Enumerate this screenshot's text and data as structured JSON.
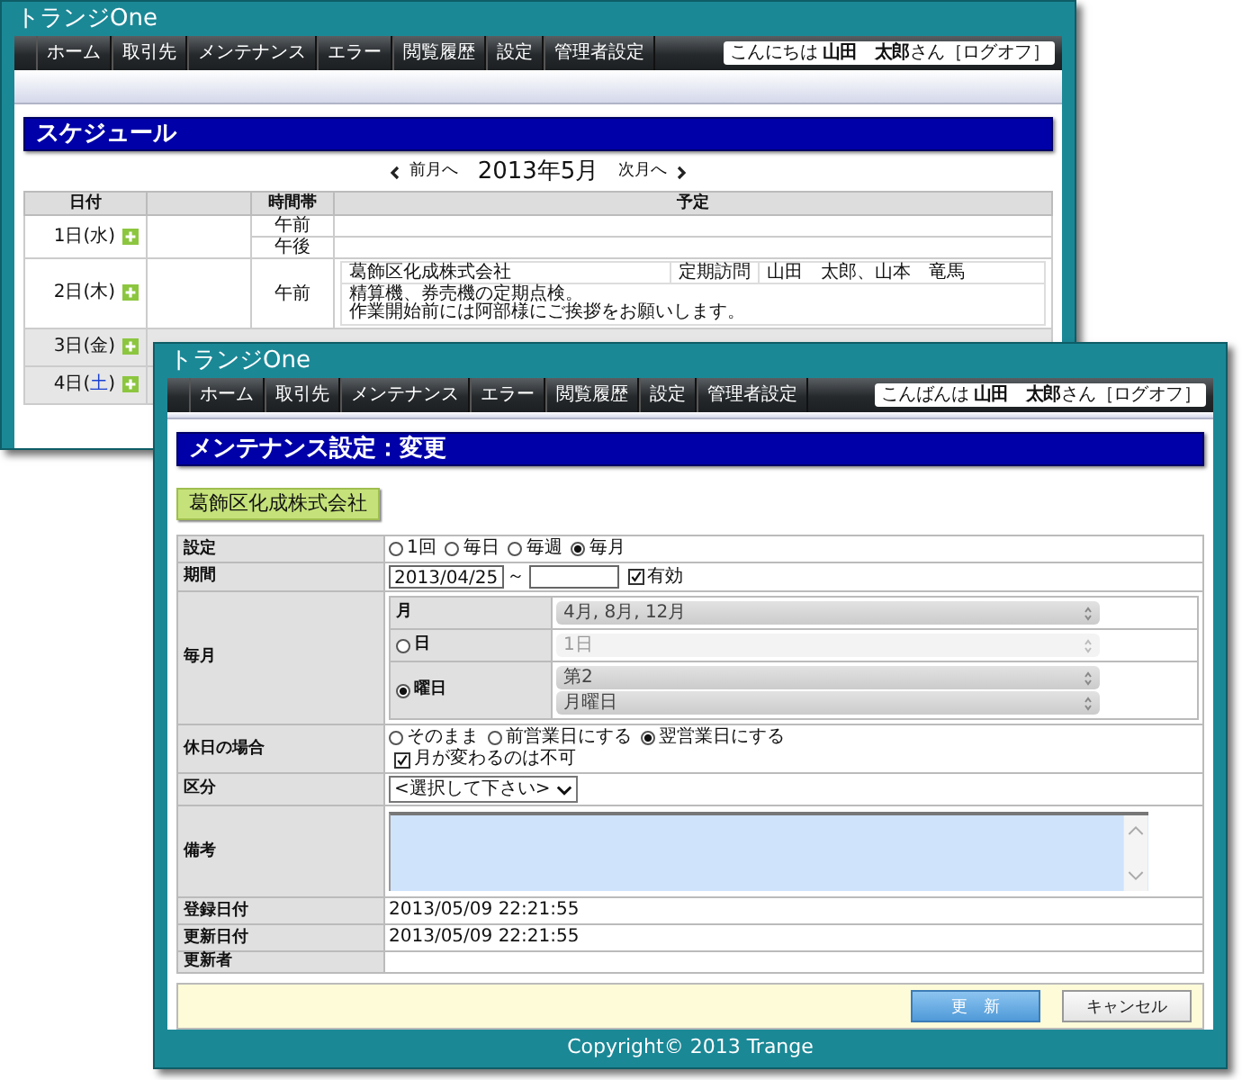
{
  "back_window": {
    "title": "トランジOne",
    "nav": [
      "ホーム",
      "取引先",
      "メンテナンス",
      "エラー",
      "閲覧履歴",
      "設定",
      "管理者設定"
    ],
    "greeting": "こんにちは **山田　太郎**さん",
    "logoff": "［ログオフ］",
    "heading": "スケジュール",
    "month_nav": {
      "prev": "前月へ",
      "current": "2013年5月",
      "next": "次月へ"
    },
    "columns": [
      "日付",
      "時間帯",
      "予定"
    ],
    "days": [
      {
        "prefix": "1日(",
        "weekday": "水",
        "suffix": ")",
        "weekend": false,
        "shaded": false,
        "slots": [
          {
            "time": "午前"
          },
          {
            "time": "午後"
          }
        ]
      },
      {
        "prefix": "2日(",
        "weekday": "木",
        "suffix": ")",
        "weekend": false,
        "shaded": false,
        "slots": [
          {
            "time": "午前",
            "entry": {
              "client": "葛飾区化成株式会社",
              "type": "定期訪問",
              "staff": "山田　太郎、山本　竜馬",
              "note": [
                "精算機、券売機の定期点検。",
                "作業開始前には阿部様にご挨拶をお願いします。"
              ]
            }
          }
        ]
      },
      {
        "prefix": "3日(",
        "weekday": "金",
        "suffix": ")",
        "weekend": false,
        "shaded": true
      },
      {
        "prefix": "4日(",
        "weekday": "土",
        "suffix": ")",
        "weekend": true,
        "shaded": true
      }
    ]
  },
  "front_window": {
    "title": "トランジOne",
    "nav": [
      "ホーム",
      "取引先",
      "メンテナンス",
      "エラー",
      "閲覧履歴",
      "設定",
      "管理者設定"
    ],
    "greeting": "こんばんは **山田　太郎**さん",
    "logoff": "［ログオフ］",
    "heading": "メンテナンス設定：変更",
    "client": "葛飾区化成株式会社",
    "form": [
      {
        "kind": "radios",
        "label": "設定",
        "options": [
          {
            "label": "1回",
            "selected": false
          },
          {
            "label": "毎日",
            "selected": false
          },
          {
            "label": "毎週",
            "selected": false
          },
          {
            "label": "毎月",
            "selected": true
          }
        ]
      },
      {
        "kind": "period",
        "label": "期間",
        "start": "2013/04/25",
        "separator": "～",
        "checkbox": {
          "label": "有効",
          "checked": true
        }
      },
      {
        "kind": "monthly",
        "label": "毎月",
        "month_label": "月",
        "month_value": "4月, 8月, 12月",
        "day": {
          "label": "日",
          "selected": false,
          "value": "1日"
        },
        "weekday": {
          "label": "曜日",
          "selected": true,
          "values": [
            "第2",
            "月曜日"
          ]
        }
      },
      {
        "kind": "holiday",
        "label": "休日の場合",
        "options": [
          {
            "label": "そのまま",
            "selected": false
          },
          {
            "label": "前営業日にする",
            "selected": false
          },
          {
            "label": "翌営業日にする",
            "selected": true
          }
        ],
        "checkbox": {
          "label": "月が変わるのは不可",
          "checked": true
        }
      },
      {
        "kind": "select",
        "label": "区分",
        "value": "<選択して下さい>"
      },
      {
        "kind": "textarea",
        "label": "備考"
      },
      {
        "kind": "text",
        "label": "登録日付",
        "value": "2013/05/09 22:21:55"
      },
      {
        "kind": "text",
        "label": "更新日付",
        "value": "2013/05/09 22:21:55"
      },
      {
        "kind": "text",
        "label": "更新者"
      }
    ],
    "buttons": [
      {
        "label": "更　新",
        "primary": true
      },
      {
        "label": "キャンセル",
        "primary": false
      }
    ],
    "footer": "Copyright© 2013 Trange"
  }
}
